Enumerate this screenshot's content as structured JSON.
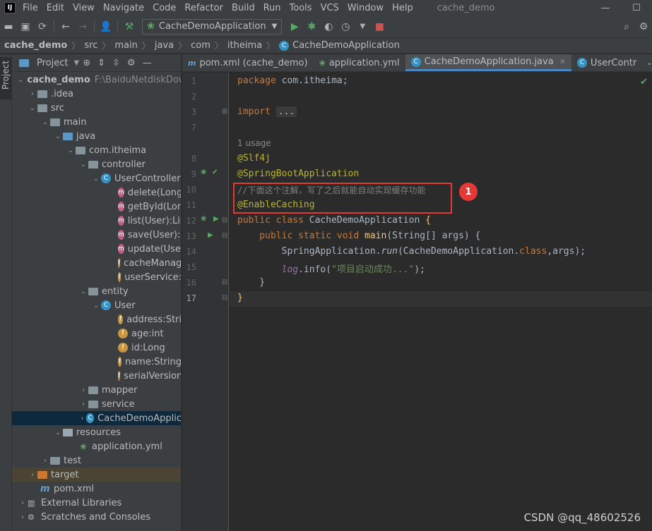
{
  "menubar": {
    "logo": "IJ",
    "items": [
      "File",
      "Edit",
      "View",
      "Navigate",
      "Code",
      "Refactor",
      "Build",
      "Run",
      "Tools",
      "VCS",
      "Window",
      "Help"
    ],
    "title": "cache_demo"
  },
  "toolbar": {
    "run_config": "CacheDemoApplication"
  },
  "breadcrumb": [
    "cache_demo",
    "src",
    "main",
    "java",
    "com",
    "itheima",
    "CacheDemoApplication"
  ],
  "stripe": {
    "project_tab": "Project"
  },
  "project": {
    "header_title": "Project",
    "tree": [
      {
        "label": "cache_demo",
        "extra": "F:\\BaiduNetdiskDow",
        "bold": true
      },
      {
        "label": ".idea"
      },
      {
        "label": "src"
      },
      {
        "label": "main"
      },
      {
        "label": "java"
      },
      {
        "label": "com.itheima"
      },
      {
        "label": "controller"
      },
      {
        "label": "UserController"
      },
      {
        "label": "delete(Long"
      },
      {
        "label": "getById(Lon"
      },
      {
        "label": "list(User):Lis"
      },
      {
        "label": "save(User):U"
      },
      {
        "label": "update(User"
      },
      {
        "label": "cacheManag"
      },
      {
        "label": "userService:"
      },
      {
        "label": "entity"
      },
      {
        "label": "User"
      },
      {
        "label": "address:Stri"
      },
      {
        "label": "age:int"
      },
      {
        "label": "id:Long"
      },
      {
        "label": "name:String"
      },
      {
        "label": "serialVersion"
      },
      {
        "label": "mapper"
      },
      {
        "label": "service"
      },
      {
        "label": "CacheDemoApplic"
      },
      {
        "label": "resources"
      },
      {
        "label": "application.yml"
      },
      {
        "label": "test"
      },
      {
        "label": "target"
      },
      {
        "label": "pom.xml"
      },
      {
        "label": "External Libraries"
      },
      {
        "label": "Scratches and Consoles"
      }
    ]
  },
  "tabs": [
    {
      "label": "pom.xml (cache_demo)"
    },
    {
      "label": "application.yml"
    },
    {
      "label": "CacheDemoApplication.java"
    },
    {
      "label": "UserContr"
    }
  ],
  "editor": {
    "line_numbers": [
      "1",
      "2",
      "3",
      "7",
      "8",
      "9",
      "10",
      "11",
      "12",
      "13",
      "14",
      "15",
      "16",
      "17"
    ],
    "usage_hint": "1 usage",
    "code": {
      "l1_kw": "package",
      "l1_rest": " com.itheima;",
      "l3_kw": "import",
      "l3_fold": "...",
      "l8": "@Slf4j",
      "l9": "@SpringBootApplication",
      "l10": "//下面这个注解，写了之后就能自动实现缓存功能",
      "l11": "@EnableCaching",
      "l12_kw": "public class",
      "l12_name": " CacheDemoApplication ",
      "l12_brace": "{",
      "l13_kw": "    public static void",
      "l13_fn": " main",
      "l13_rest": "(String[] args) {",
      "l14_a": "        SpringApplication.",
      "l14_run": "run",
      "l14_b": "(CacheDemoApplication.",
      "l14_class": "class",
      "l14_c": ",args);",
      "l15_log": "        log",
      "l15_a": ".info(",
      "l15_str": "\"项目启动成功...\"",
      "l15_b": ");",
      "l16": "    }",
      "l17": "}"
    },
    "annotation_badge": "1"
  },
  "watermark": "CSDN @qq_48602526"
}
